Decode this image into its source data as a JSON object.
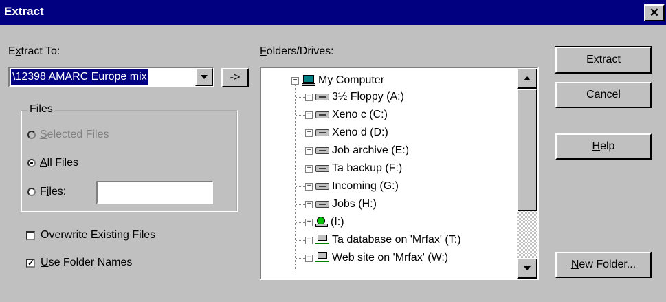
{
  "window": {
    "title": "Extract",
    "close_glyph": "✕"
  },
  "extract_to": {
    "label_pre": "E",
    "label_accel": "x",
    "label_post": "tract To:",
    "value": "\\12398 AMARC Europe mix",
    "arrow_label": "->"
  },
  "files_group": {
    "legend": "Files",
    "selected_accel": "S",
    "selected_rest": "elected Files",
    "all_accel": "A",
    "all_rest": "ll Files",
    "files_pre": "F",
    "files_accel": "i",
    "files_post": "les:",
    "selected_option": "all"
  },
  "overwrite": {
    "accel": "O",
    "rest": "verwrite Existing Files",
    "checked": false
  },
  "folder_names": {
    "accel": "U",
    "rest": "se Folder Names",
    "checked": true,
    "mark": "✓"
  },
  "folders": {
    "label_accel": "F",
    "label_rest": "olders/Drives:",
    "root": "My Computer",
    "items": [
      {
        "label": "3½ Floppy (A:)",
        "icon": "floppy-drive-icon"
      },
      {
        "label": "Xeno c (C:)",
        "icon": "hard-drive-icon"
      },
      {
        "label": "Xeno d (D:)",
        "icon": "hard-drive-icon"
      },
      {
        "label": "Job archive (E:)",
        "icon": "hard-drive-icon"
      },
      {
        "label": "Ta backup (F:)",
        "icon": "hard-drive-icon"
      },
      {
        "label": "Incoming (G:)",
        "icon": "hard-drive-icon"
      },
      {
        "label": "Jobs (H:)",
        "icon": "hard-drive-icon"
      },
      {
        "label": "(I:)",
        "icon": "cd-drive-icon"
      },
      {
        "label": "Ta database on 'Mrfax' (T:)",
        "icon": "network-drive-icon"
      },
      {
        "label": "Web site on 'Mrfax' (W:)",
        "icon": "network-drive-icon"
      }
    ]
  },
  "buttons": {
    "extract": "Extract",
    "cancel": "Cancel",
    "help_accel": "H",
    "help_rest": "elp",
    "newfolder_accel": "N",
    "newfolder_rest": "ew Folder..."
  }
}
